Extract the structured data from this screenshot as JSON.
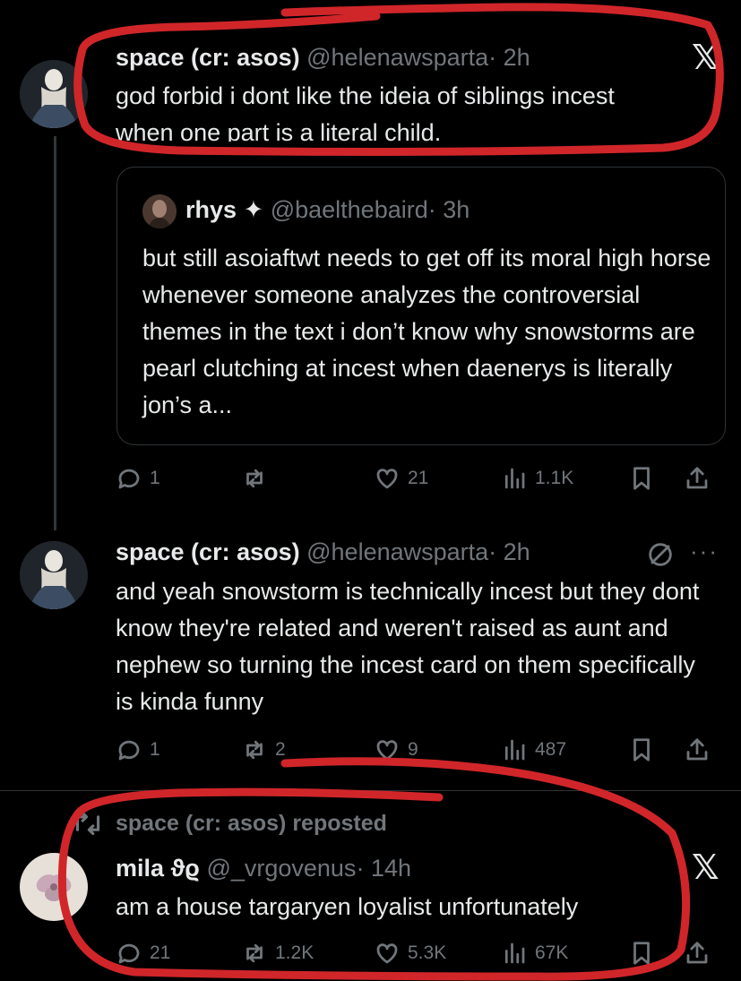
{
  "tweet1": {
    "name": "space (cr: asos)",
    "handle": "@helenawsparta",
    "time": "· 2h",
    "text_line1": "god forbid i dont like the ideia of siblings incest",
    "text_line2": "when one part is a literal child.",
    "quote": {
      "name": "rhys",
      "badge": "✦",
      "handle": "@baelthebaird",
      "time": "· 3h",
      "text": "but still asoiaftwt needs to get off its moral high horse whenever someone analyzes the controversial themes in the text i don’t know why snowstorms are pearl clutching at incest when daenerys is literally jon’s a..."
    },
    "actions": {
      "replies": "1",
      "reposts": "",
      "likes": "21",
      "views": "1.1K"
    }
  },
  "tweet2": {
    "name": "space (cr: asos)",
    "handle": "@helenawsparta",
    "time": "· 2h",
    "text": "and yeah snowstorm is technically incest but they dont know they're related and weren't raised as aunt and nephew so turning the incest card on them specifically is kinda funny",
    "actions": {
      "replies": "1",
      "reposts": "2",
      "likes": "9",
      "views": "487"
    }
  },
  "tweet3": {
    "repost_label": "space (cr: asos) reposted",
    "name": "mila ϑϱ",
    "handle": "@_vrgovenus",
    "time": "· 14h",
    "text": "am a house targaryen loyalist unfortunately",
    "actions": {
      "replies": "21",
      "reposts": "1.2K",
      "likes": "5.3K",
      "views": "67K"
    }
  },
  "colors": {
    "background": "#000000",
    "text": "#e7e9ea",
    "muted": "#71767b",
    "border": "#2f3336",
    "annotation": "#d0262a"
  },
  "icons": [
    "reply-icon",
    "repost-icon",
    "like-icon",
    "views-icon",
    "bookmark-icon",
    "share-icon",
    "x-logo-icon",
    "grok-icon",
    "more-icon"
  ]
}
